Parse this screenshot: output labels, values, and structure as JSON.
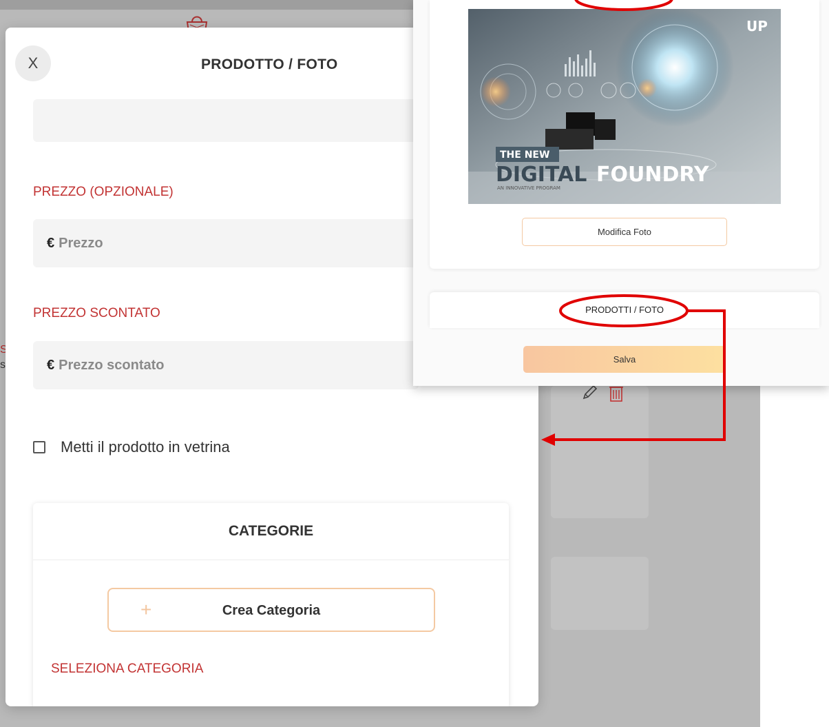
{
  "modal": {
    "close_label": "X",
    "title": "PRODOTTO / FOTO",
    "price_label": "PREZZO (OPZIONALE)",
    "currency": "€",
    "price_placeholder": "Prezzo",
    "discount_label": "PREZZO SCONTATO",
    "discount_placeholder": "Prezzo scontato",
    "showcase_checkbox_label": "Metti il prodotto in vetrina",
    "showcase_checked": false,
    "categories": {
      "header": "CATEGORIE",
      "create_button": "Crea Categoria",
      "select_label": "SELEZIONA CATEGORIA"
    }
  },
  "preview_panel": {
    "photo_text": {
      "line1": "THE NEW",
      "line2a": "DIGITAL",
      "line2b": "FOUNDRY",
      "tagline": "AN INNOVATIVE PROGRAM",
      "logo": "UP"
    },
    "edit_photo_button": "Modifica Foto",
    "section_title": "PRODOTTI / FOTO",
    "save_button": "Salva"
  },
  "colors": {
    "accent_red": "#c23333",
    "annotation_red": "#e00000",
    "button_border": "#f4c9a2",
    "save_gradient_start": "#f8c6a0",
    "save_gradient_end": "#fde0a0",
    "scroll_accent": "#e6b21c"
  }
}
